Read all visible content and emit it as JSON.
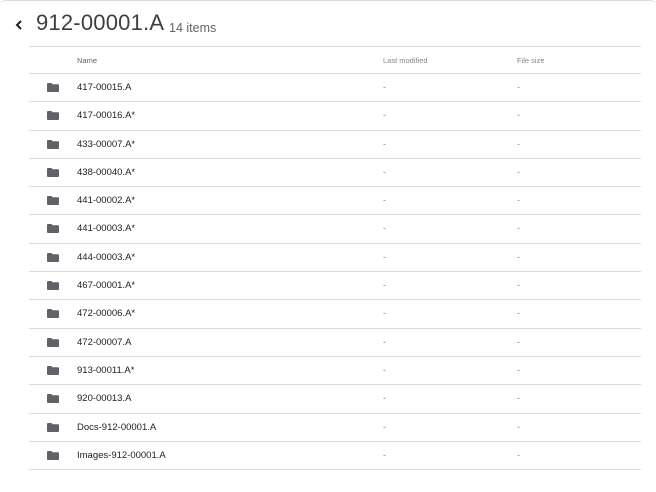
{
  "header": {
    "title": "912-00001.A",
    "item_count": "14 items"
  },
  "table": {
    "columns": {
      "name": "Name",
      "last_modified": "Last modified",
      "file_size": "File size"
    },
    "rows": [
      {
        "name": "417-00015.A",
        "last_modified": "-",
        "file_size": "-"
      },
      {
        "name": "417-00016.A*",
        "last_modified": "-",
        "file_size": "-"
      },
      {
        "name": "433-00007.A*",
        "last_modified": "-",
        "file_size": "-"
      },
      {
        "name": "438-00040.A*",
        "last_modified": "-",
        "file_size": "-"
      },
      {
        "name": "441-00002.A*",
        "last_modified": "-",
        "file_size": "-"
      },
      {
        "name": "441-00003.A*",
        "last_modified": "-",
        "file_size": "-"
      },
      {
        "name": "444-00003.A*",
        "last_modified": "-",
        "file_size": "-"
      },
      {
        "name": "467-00001.A*",
        "last_modified": "-",
        "file_size": "-"
      },
      {
        "name": "472-00006.A*",
        "last_modified": "-",
        "file_size": "-"
      },
      {
        "name": "472-00007.A",
        "last_modified": "-",
        "file_size": "-"
      },
      {
        "name": "913-00011.A*",
        "last_modified": "-",
        "file_size": "-"
      },
      {
        "name": "920-00013.A",
        "last_modified": "-",
        "file_size": "-"
      },
      {
        "name": "Docs-912-00001.A",
        "last_modified": "-",
        "file_size": "-"
      },
      {
        "name": "Images-912-00001.A",
        "last_modified": "-",
        "file_size": "-"
      }
    ],
    "row_icon": "folder-icon"
  },
  "colors": {
    "divider": "#dadce0",
    "folder": "#5f6368",
    "muted_text": "#80868b"
  }
}
